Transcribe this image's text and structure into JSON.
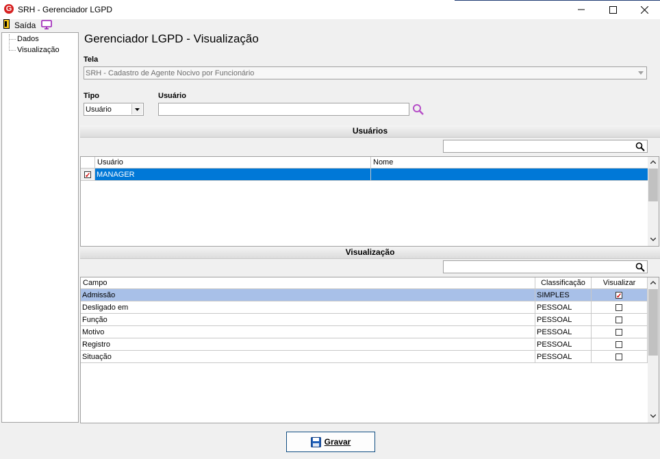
{
  "window": {
    "title": "SRH - Gerenciador LGPD",
    "logo_letter": "G"
  },
  "toolbar": {
    "exit_label": "Saída"
  },
  "tree": {
    "items": [
      "Dados",
      "Visualização"
    ]
  },
  "page": {
    "title": "Gerenciador LGPD - Visualização"
  },
  "form": {
    "tela_label": "Tela",
    "tela_value": "SRH - Cadastro de Agente Nocivo por Funcionário",
    "tipo_label": "Tipo",
    "tipo_value": "Usuário",
    "usuario_label": "Usuário",
    "usuario_value": ""
  },
  "users_section": {
    "title": "Usuários",
    "search_value": "",
    "columns": [
      "Usuário",
      "Nome"
    ],
    "rows": [
      {
        "checked": true,
        "usuario": "MANAGER",
        "nome": ""
      }
    ]
  },
  "view_section": {
    "title": "Visualização",
    "search_value": "",
    "columns": [
      "Campo",
      "Classificação",
      "Visualizar"
    ],
    "rows": [
      {
        "campo": "Admissão",
        "classificacao": "SIMPLES",
        "visualizar": true
      },
      {
        "campo": "Desligado em",
        "classificacao": "PESSOAL",
        "visualizar": false
      },
      {
        "campo": "Função",
        "classificacao": "PESSOAL",
        "visualizar": false
      },
      {
        "campo": "Motivo",
        "classificacao": "PESSOAL",
        "visualizar": false
      },
      {
        "campo": "Registro",
        "classificacao": "PESSOAL",
        "visualizar": false
      },
      {
        "campo": "Situação",
        "classificacao": "PESSOAL",
        "visualizar": false
      }
    ]
  },
  "actions": {
    "save_label": "Gravar"
  },
  "colors": {
    "selected_row": "#0078d7",
    "selected_row_light": "#a8c0e8",
    "button_border": "#0f4c81"
  },
  "icons": {
    "search": "magnifier-icon",
    "save": "floppy-disk-icon",
    "monitor": "monitor-icon",
    "exit": "door-exit-icon"
  }
}
